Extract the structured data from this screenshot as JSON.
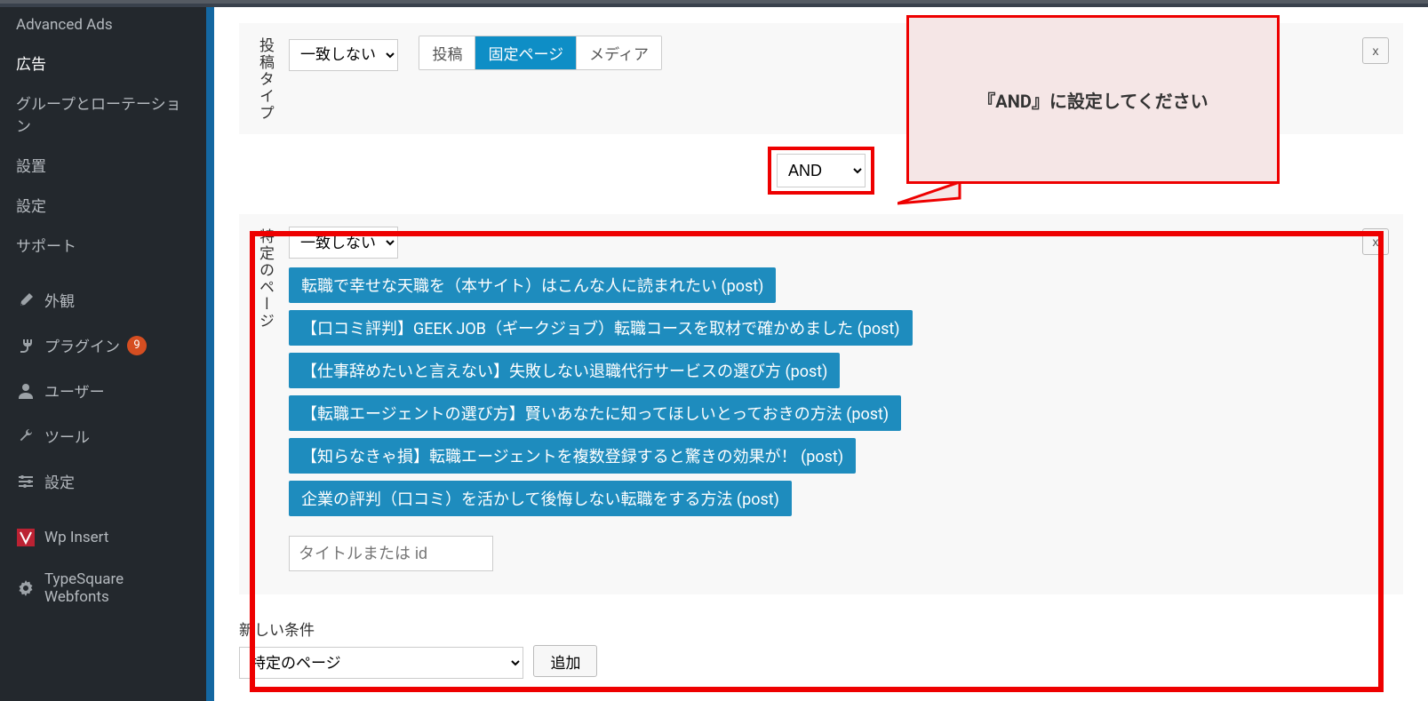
{
  "sidebar": {
    "items": [
      {
        "label": "Advanced Ads",
        "icon": ""
      },
      {
        "label": "広告",
        "icon": ""
      },
      {
        "label": "グループとローテーション",
        "icon": ""
      },
      {
        "label": "設置",
        "icon": ""
      },
      {
        "label": "設定",
        "icon": ""
      },
      {
        "label": "サポート",
        "icon": ""
      },
      {
        "label": "外観",
        "icon": "brush"
      },
      {
        "label": "プラグイン",
        "icon": "plug",
        "badge": "9"
      },
      {
        "label": "ユーザー",
        "icon": "user"
      },
      {
        "label": "ツール",
        "icon": "wrench"
      },
      {
        "label": "設定",
        "icon": "sliders"
      },
      {
        "label": "Wp Insert",
        "icon": "wpinsert"
      },
      {
        "label": "TypeSquare Webfonts",
        "icon": "gear"
      }
    ]
  },
  "condition1": {
    "label": "投稿タイプ",
    "select": "一致しない",
    "options": [
      "一致しない"
    ],
    "toggles": [
      "投稿",
      "固定ページ",
      "メディア"
    ],
    "active_toggle_index": 1,
    "remove": "x"
  },
  "connector": {
    "value": "AND"
  },
  "condition2": {
    "label": "特定のページ",
    "select": "一致しない",
    "options": [
      "一致しない"
    ],
    "tags": [
      "転職で幸せな天職を（本サイト）はこんな人に読まれたい (post)",
      "【口コミ評判】GEEK JOB（ギークジョブ）転職コースを取材で確かめました (post)",
      "【仕事辞めたいと言えない】失敗しない退職代行サービスの選び方 (post)",
      "【転職エージェントの選び方】賢いあなたに知ってほしいとっておきの方法 (post)",
      "【知らなきゃ損】転職エージェントを複数登録すると驚きの効果が！ (post)",
      "企業の評判（口コミ）を活かして後悔しない転職をする方法 (post)"
    ],
    "search_placeholder": "タイトルまたは id",
    "remove": "x"
  },
  "new_condition": {
    "label": "新しい条件",
    "select": "特定のページ",
    "add_label": "追加"
  },
  "callout": {
    "text": "『AND』に設定してください"
  }
}
